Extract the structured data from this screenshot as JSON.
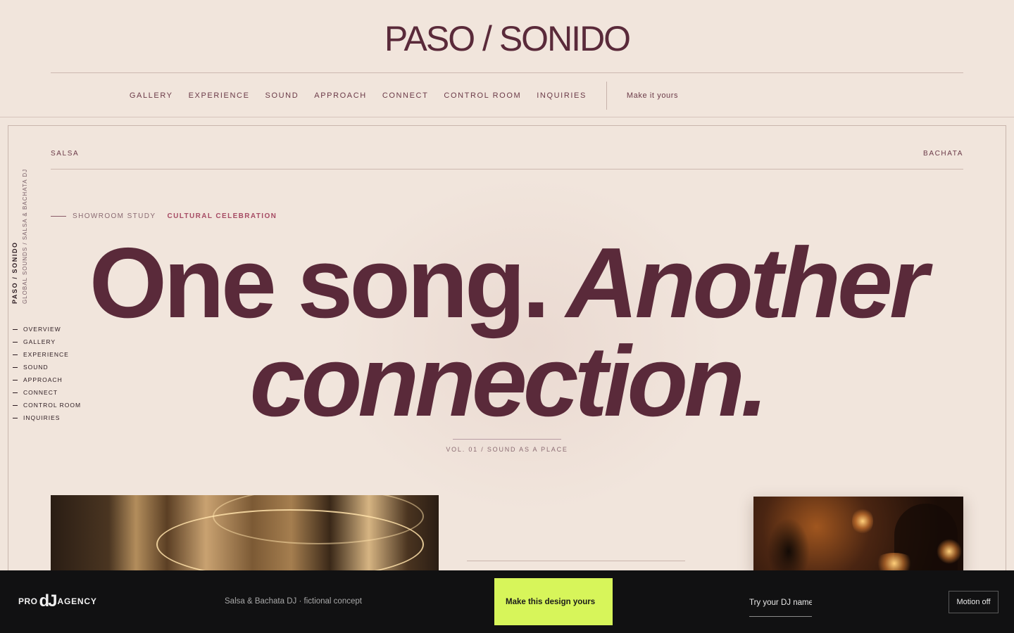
{
  "site": {
    "logo": "PASO / SONIDO"
  },
  "nav": {
    "items": [
      "GALLERY",
      "EXPERIENCE",
      "SOUND",
      "APPROACH",
      "CONNECT",
      "CONTROL ROOM",
      "INQUIRIES"
    ],
    "cta": "Make it yours"
  },
  "genres": {
    "left": "SALSA",
    "right": "BACHATA"
  },
  "vertical": {
    "brand": "PASO / SONIDO",
    "subtitle": "GLOBAL SOUNDS / SALSA & BACHATA DJ"
  },
  "side_nav": {
    "items": [
      "OVERVIEW",
      "GALLERY",
      "EXPERIENCE",
      "SOUND",
      "APPROACH",
      "CONNECT",
      "CONTROL ROOM",
      "INQUIRIES"
    ]
  },
  "hero": {
    "eyebrow_label": "SHOWROOM STUDY",
    "eyebrow_accent": "CULTURAL CELEBRATION",
    "headline_part1": "One song.",
    "headline_part2": "Another",
    "headline_part3": "connection.",
    "volume": "VOL. 01 / SOUND AS A PLACE"
  },
  "footer_bar": {
    "brand_pro": "PRO",
    "brand_dj": "dJ",
    "brand_agency": "AGENCY",
    "concept": "Salsa & Bachata DJ · fictional concept",
    "make_button": "Make this design yours",
    "dj_name_placeholder": "Try your DJ name",
    "motion_button": "Motion off"
  },
  "colors": {
    "background": "#f1e5dc",
    "accent": "#5a2a3a",
    "highlight": "#a64b64",
    "cta": "#d7f55a",
    "bar": "#111112"
  }
}
